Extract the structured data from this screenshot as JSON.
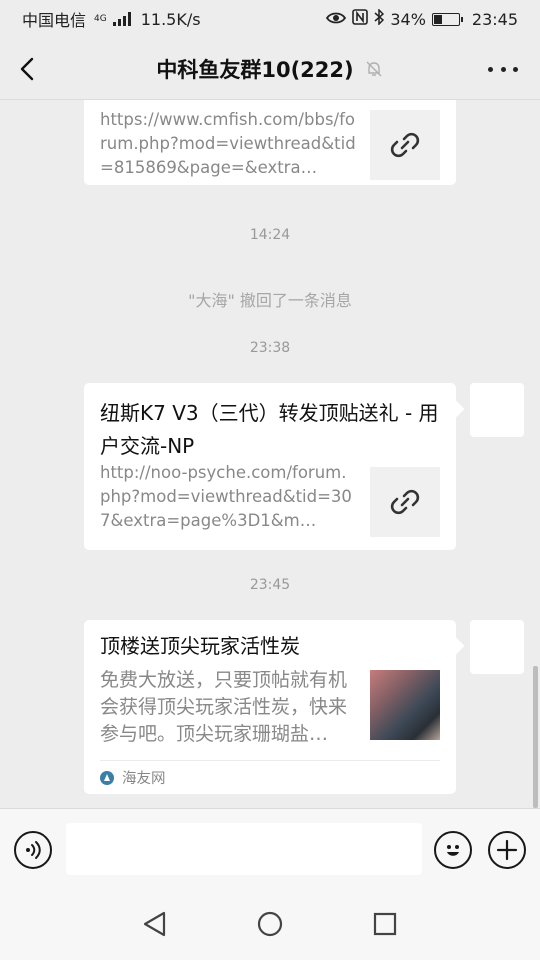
{
  "status_bar": {
    "carrier": "中国电信",
    "network": "4G",
    "speed": "11.5K/s",
    "battery": "34%",
    "battery_level": 0.34,
    "time": "23:45"
  },
  "header": {
    "title": "中科鱼友群10(222)",
    "icons": [
      "back-arrow",
      "muted-bell",
      "more-dots"
    ]
  },
  "messages": [
    {
      "type": "link",
      "desc": "https://www.cmfish.com/bbs/forum.php?mod=viewthread&tid=815869&page=&extra…"
    },
    {
      "type": "time",
      "text": "14:24"
    },
    {
      "type": "system",
      "text": "\"大海\" 撤回了一条消息"
    },
    {
      "type": "time",
      "text": "23:38"
    },
    {
      "type": "link",
      "title": "纽斯K7 V3（三代）转发顶贴送礼 - 用户交流-NP",
      "desc": "http://noo-psyche.com/forum.php?mod=viewthread&tid=307&extra=page%3D1&m…"
    },
    {
      "type": "time",
      "text": "23:45"
    },
    {
      "type": "article",
      "title": "顶楼送顶尖玩家活性炭",
      "desc": "免费大放送，只要顶帖就有机会获得顶尖玩家活性炭，快来参与吧。顶尖玩家珊瑚盐…",
      "source": "海友网"
    }
  ],
  "input_bar": {
    "placeholder": "",
    "icons": [
      "voice-icon",
      "emoji-icon",
      "plus-icon"
    ]
  },
  "nav_bar": {
    "icons": [
      "back-triangle",
      "home-circle",
      "recents-square"
    ]
  }
}
